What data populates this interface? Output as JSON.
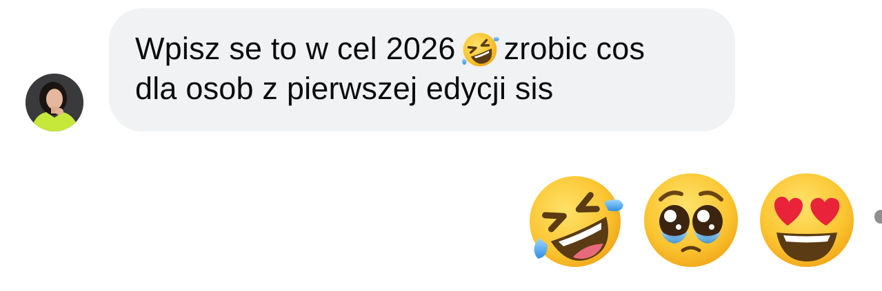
{
  "incoming_message": {
    "line1_before_emoji": "Wpisz se to w cel 2026",
    "inline_emoji_icon": "rolling-on-floor-laughing-icon",
    "line1_after_emoji": "zrobic cos",
    "line2": "dla osob z pierwszej edycji sis"
  },
  "avatar": {
    "icon": "profile-photo-avatar",
    "accent_color": "#c6e83a"
  },
  "outgoing_reaction": {
    "emojis": [
      "rolling-on-floor-laughing-icon",
      "pleading-face-icon",
      "smiling-face-with-heart-eyes-icon"
    ]
  },
  "colors": {
    "bubble_background": "#f1f2f4",
    "text": "#0b0b0b",
    "emoji_yellow": "#ffcc33",
    "tear_blue": "#4aa8ef",
    "heart_red": "#e8233a"
  }
}
